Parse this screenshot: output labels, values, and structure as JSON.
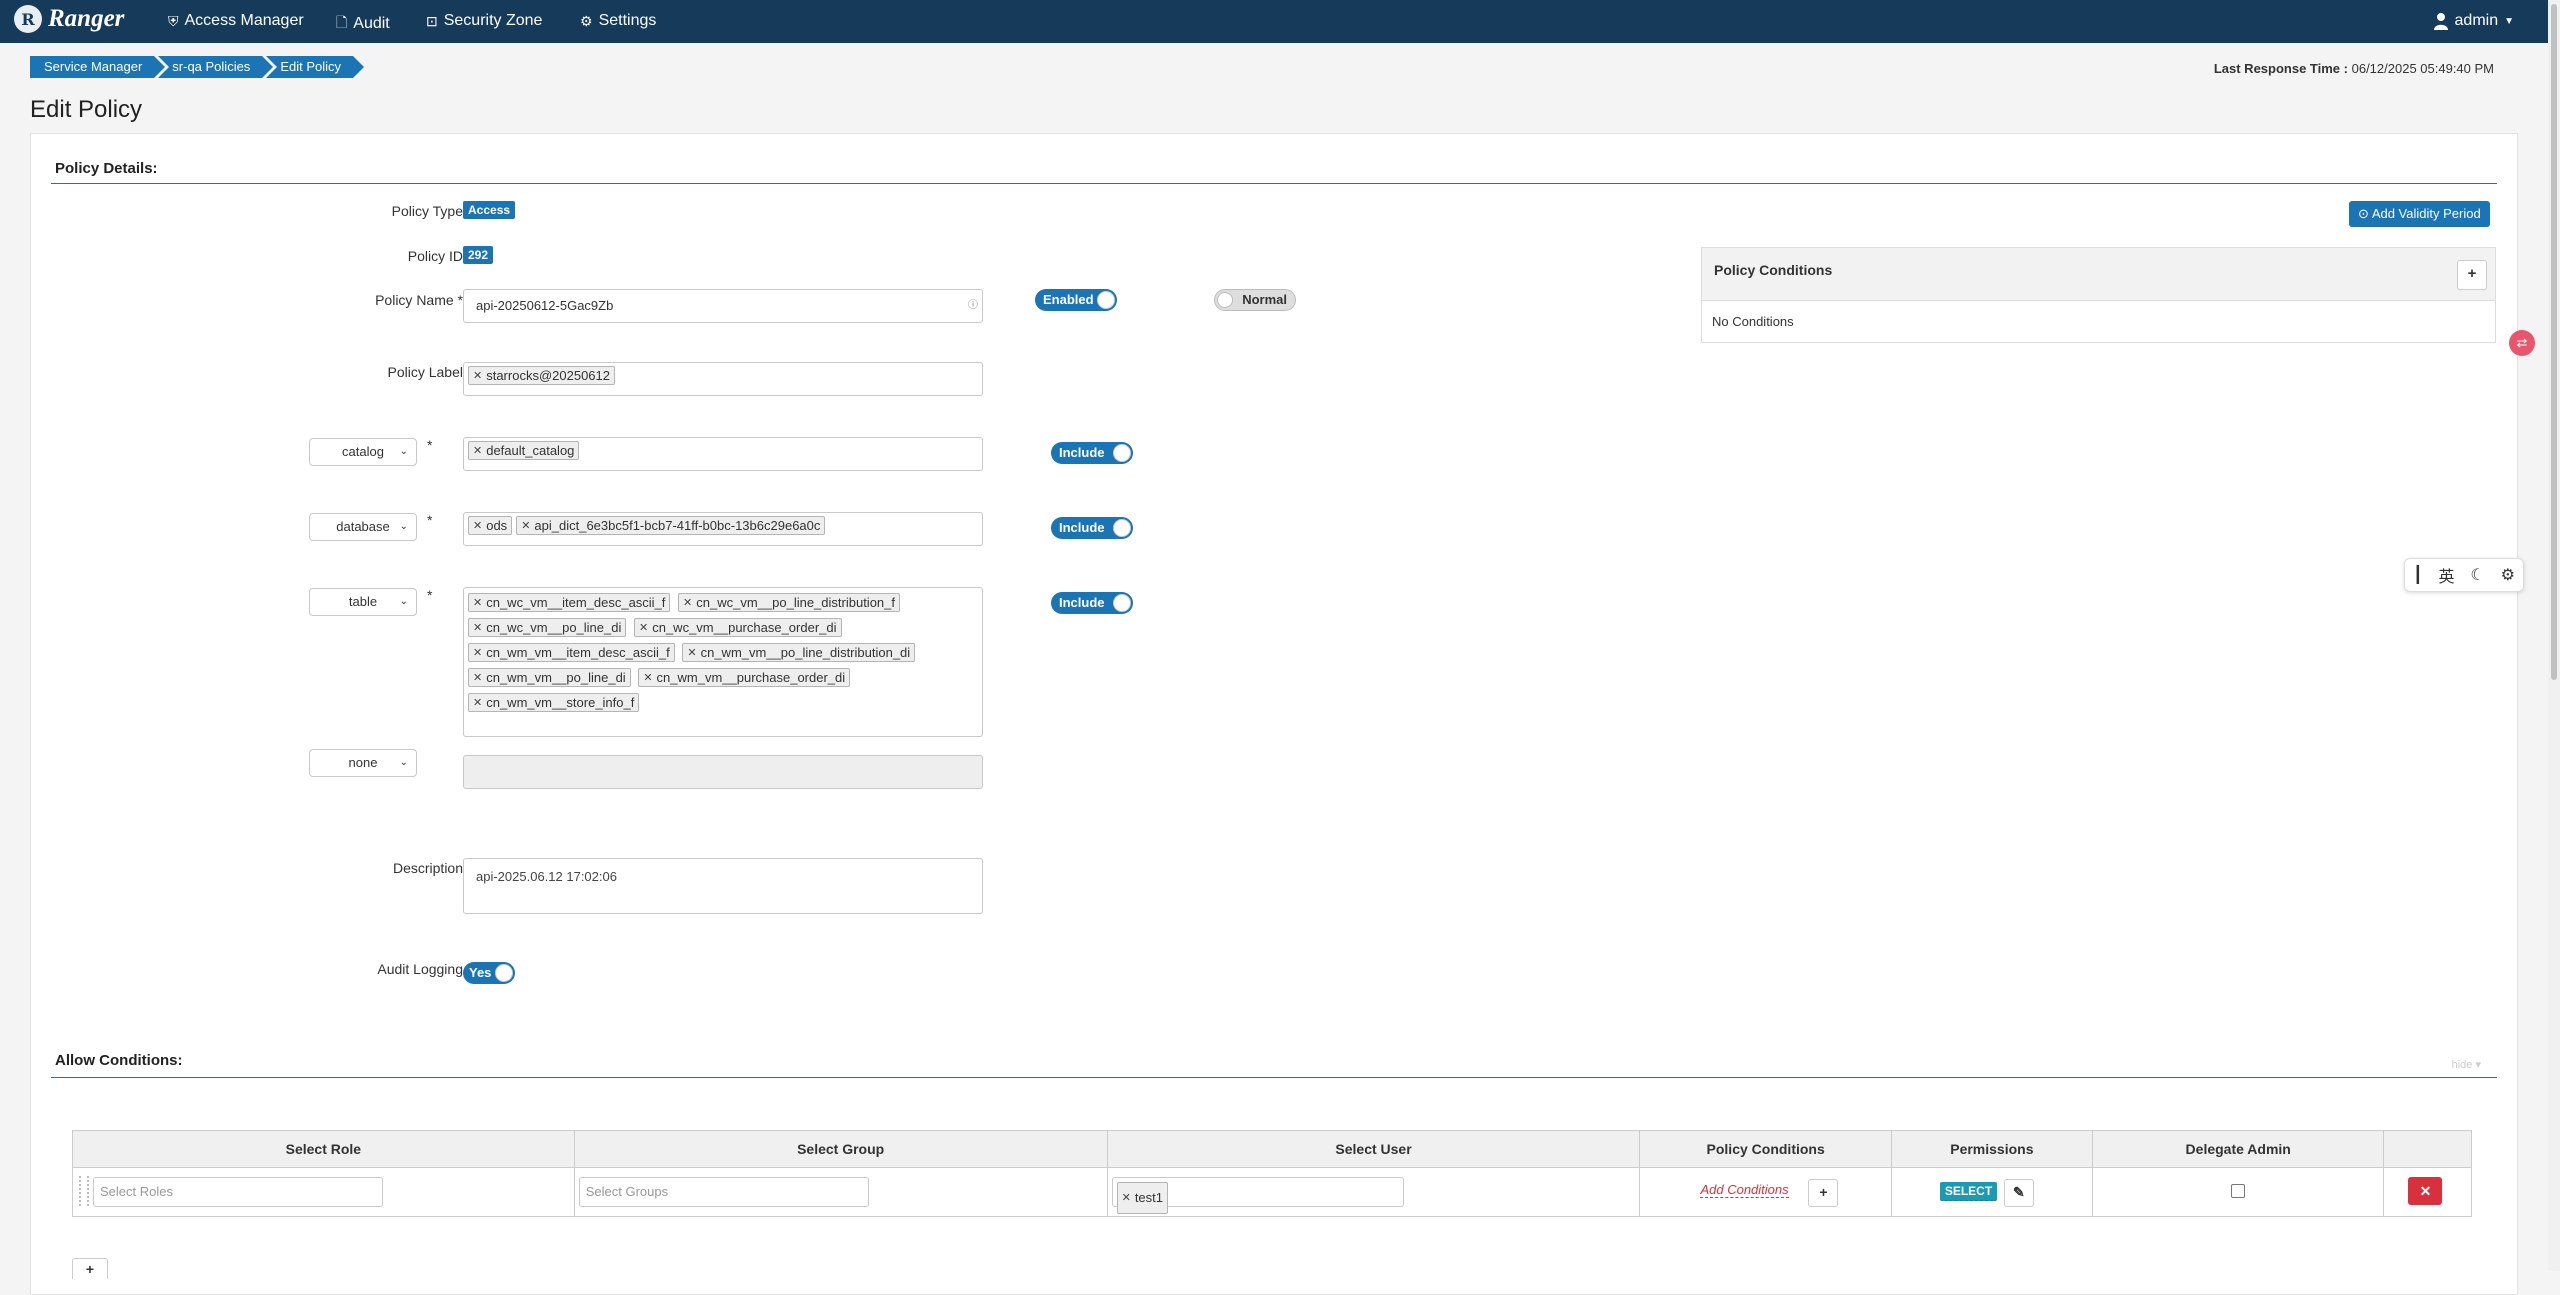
{
  "nav": {
    "brand": "Ranger",
    "logo_letter": "R",
    "items": [
      {
        "label": "Access Manager",
        "icon": "shield-icon",
        "glyph": "⛨"
      },
      {
        "label": "Audit",
        "icon": "file-icon",
        "glyph": "🗋"
      },
      {
        "label": "Security Zone",
        "icon": "zone-icon",
        "glyph": "⊡"
      },
      {
        "label": "Settings",
        "icon": "gear-icon",
        "glyph": "⚙"
      }
    ],
    "user": "admin",
    "user_icon": "user-icon"
  },
  "breadcrumb": [
    "Service Manager",
    "sr-qa Policies",
    "Edit Policy"
  ],
  "last_response": {
    "label": "Last Response Time :",
    "value": "06/12/2025 05:49:40 PM"
  },
  "page_title": "Edit Policy",
  "policy_details": {
    "title": "Policy Details:",
    "policy_type_label": "Policy Type",
    "policy_type": "Access",
    "policy_id_label": "Policy ID",
    "policy_id": "292",
    "policy_name_label": "Policy Name *",
    "policy_name": "api-20250612-5Gac9Zb",
    "enabled_toggle": "Enabled",
    "normal_toggle": "Normal",
    "policy_label_label": "Policy Label",
    "policy_labels": [
      "starrocks@20250612"
    ],
    "resources": [
      {
        "type": "catalog",
        "values": [
          "default_catalog"
        ],
        "include": "Include"
      },
      {
        "type": "database",
        "values": [
          "ods",
          "api_dict_6e3bc5f1-bcb7-41ff-b0bc-13b6c29e6a0c"
        ],
        "include": "Include"
      },
      {
        "type": "table",
        "values": [
          "cn_wc_vm__item_desc_ascii_f",
          "cn_wc_vm__po_line_distribution_f",
          "cn_wc_vm__po_line_di",
          "cn_wc_vm__purchase_order_di",
          "cn_wm_vm__item_desc_ascii_f",
          "cn_wm_vm__po_line_distribution_di",
          "cn_wm_vm__po_line_di",
          "cn_wm_vm__purchase_order_di",
          "cn_wm_vm__store_info_f"
        ],
        "include": "Include"
      },
      {
        "type": "none",
        "values": []
      }
    ],
    "description_label": "Description",
    "description": "api-2025.06.12 17:02:06",
    "audit_label": "Audit Logging",
    "audit_value": "Yes",
    "add_validity": "Add Validity Period",
    "conditions_title": "Policy Conditions",
    "conditions_empty": "No Conditions"
  },
  "allow": {
    "title": "Allow Conditions:",
    "hide": "hide",
    "columns": [
      "Select Role",
      "Select Group",
      "Select User",
      "Policy Conditions",
      "Permissions",
      "Delegate Admin",
      ""
    ],
    "row": {
      "role_placeholder": "Select Roles",
      "group_placeholder": "Select Groups",
      "users": [
        "test1"
      ],
      "add_conditions": "Add Conditions",
      "permission": "SELECT"
    },
    "add_row": "+"
  },
  "colors": {
    "nav": "#153a5a",
    "accent": "#1b75b4",
    "danger": "#d9303e"
  },
  "ime": {
    "lang": "英"
  }
}
